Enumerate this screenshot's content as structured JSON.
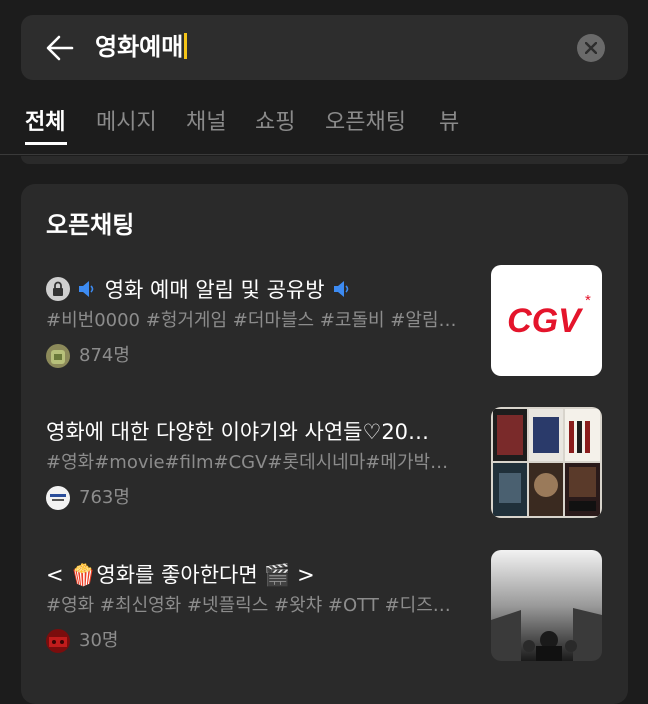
{
  "search": {
    "query": "영화예매"
  },
  "tabs": [
    {
      "label": "전체"
    },
    {
      "label": "메시지"
    },
    {
      "label": "채널"
    },
    {
      "label": "쇼핑"
    },
    {
      "label": "오픈채팅"
    },
    {
      "label": "뷰"
    }
  ],
  "section": {
    "title": "오픈채팅"
  },
  "rooms": [
    {
      "title": "영화 예매 알림 및 공유방",
      "tags": "#비번0000 #헝거게임 #더마블스 #코돌비 #알림…",
      "members": "874명",
      "thumb": "CGV"
    },
    {
      "title": "영화에 대한 다양한 이야기와 사연들♡20…",
      "tags": "#영화#movie#film#CGV#롯데시네마#메가박…",
      "members": "763명"
    },
    {
      "title": "< 🍿영화를 좋아한다면 🎬 >",
      "tags": "#영화 #최신영화 #넷플릭스 #왓챠 #OTT #디즈…",
      "members": "30명"
    }
  ],
  "colors": {
    "background": "#1c1c1c",
    "card": "#2a2a2a",
    "cgv_red": "#e4142b",
    "caret": "#f5c518"
  }
}
